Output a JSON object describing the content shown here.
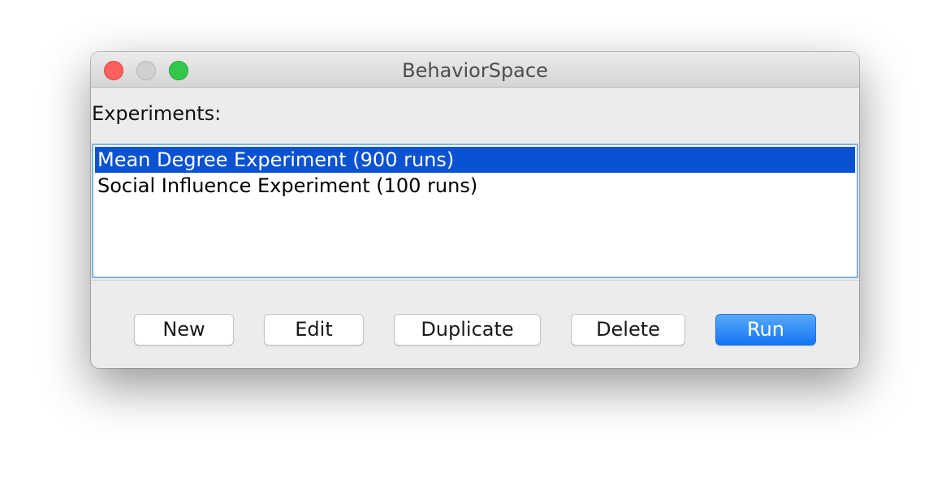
{
  "window": {
    "title": "BehaviorSpace"
  },
  "experiments": {
    "label": "Experiments:",
    "items": [
      {
        "label": "Mean Degree Experiment (900 runs)",
        "selected": true
      },
      {
        "label": "Social Influence Experiment (100 runs)",
        "selected": false
      }
    ]
  },
  "buttons": {
    "new": "New",
    "edit": "Edit",
    "duplicate": "Duplicate",
    "delete": "Delete",
    "run": "Run"
  },
  "colors": {
    "selection": "#0a52d2",
    "primary_button": "#1476f4",
    "close": "#fc605c",
    "minimize": "#d0d0d0",
    "maximize": "#34c84a"
  }
}
